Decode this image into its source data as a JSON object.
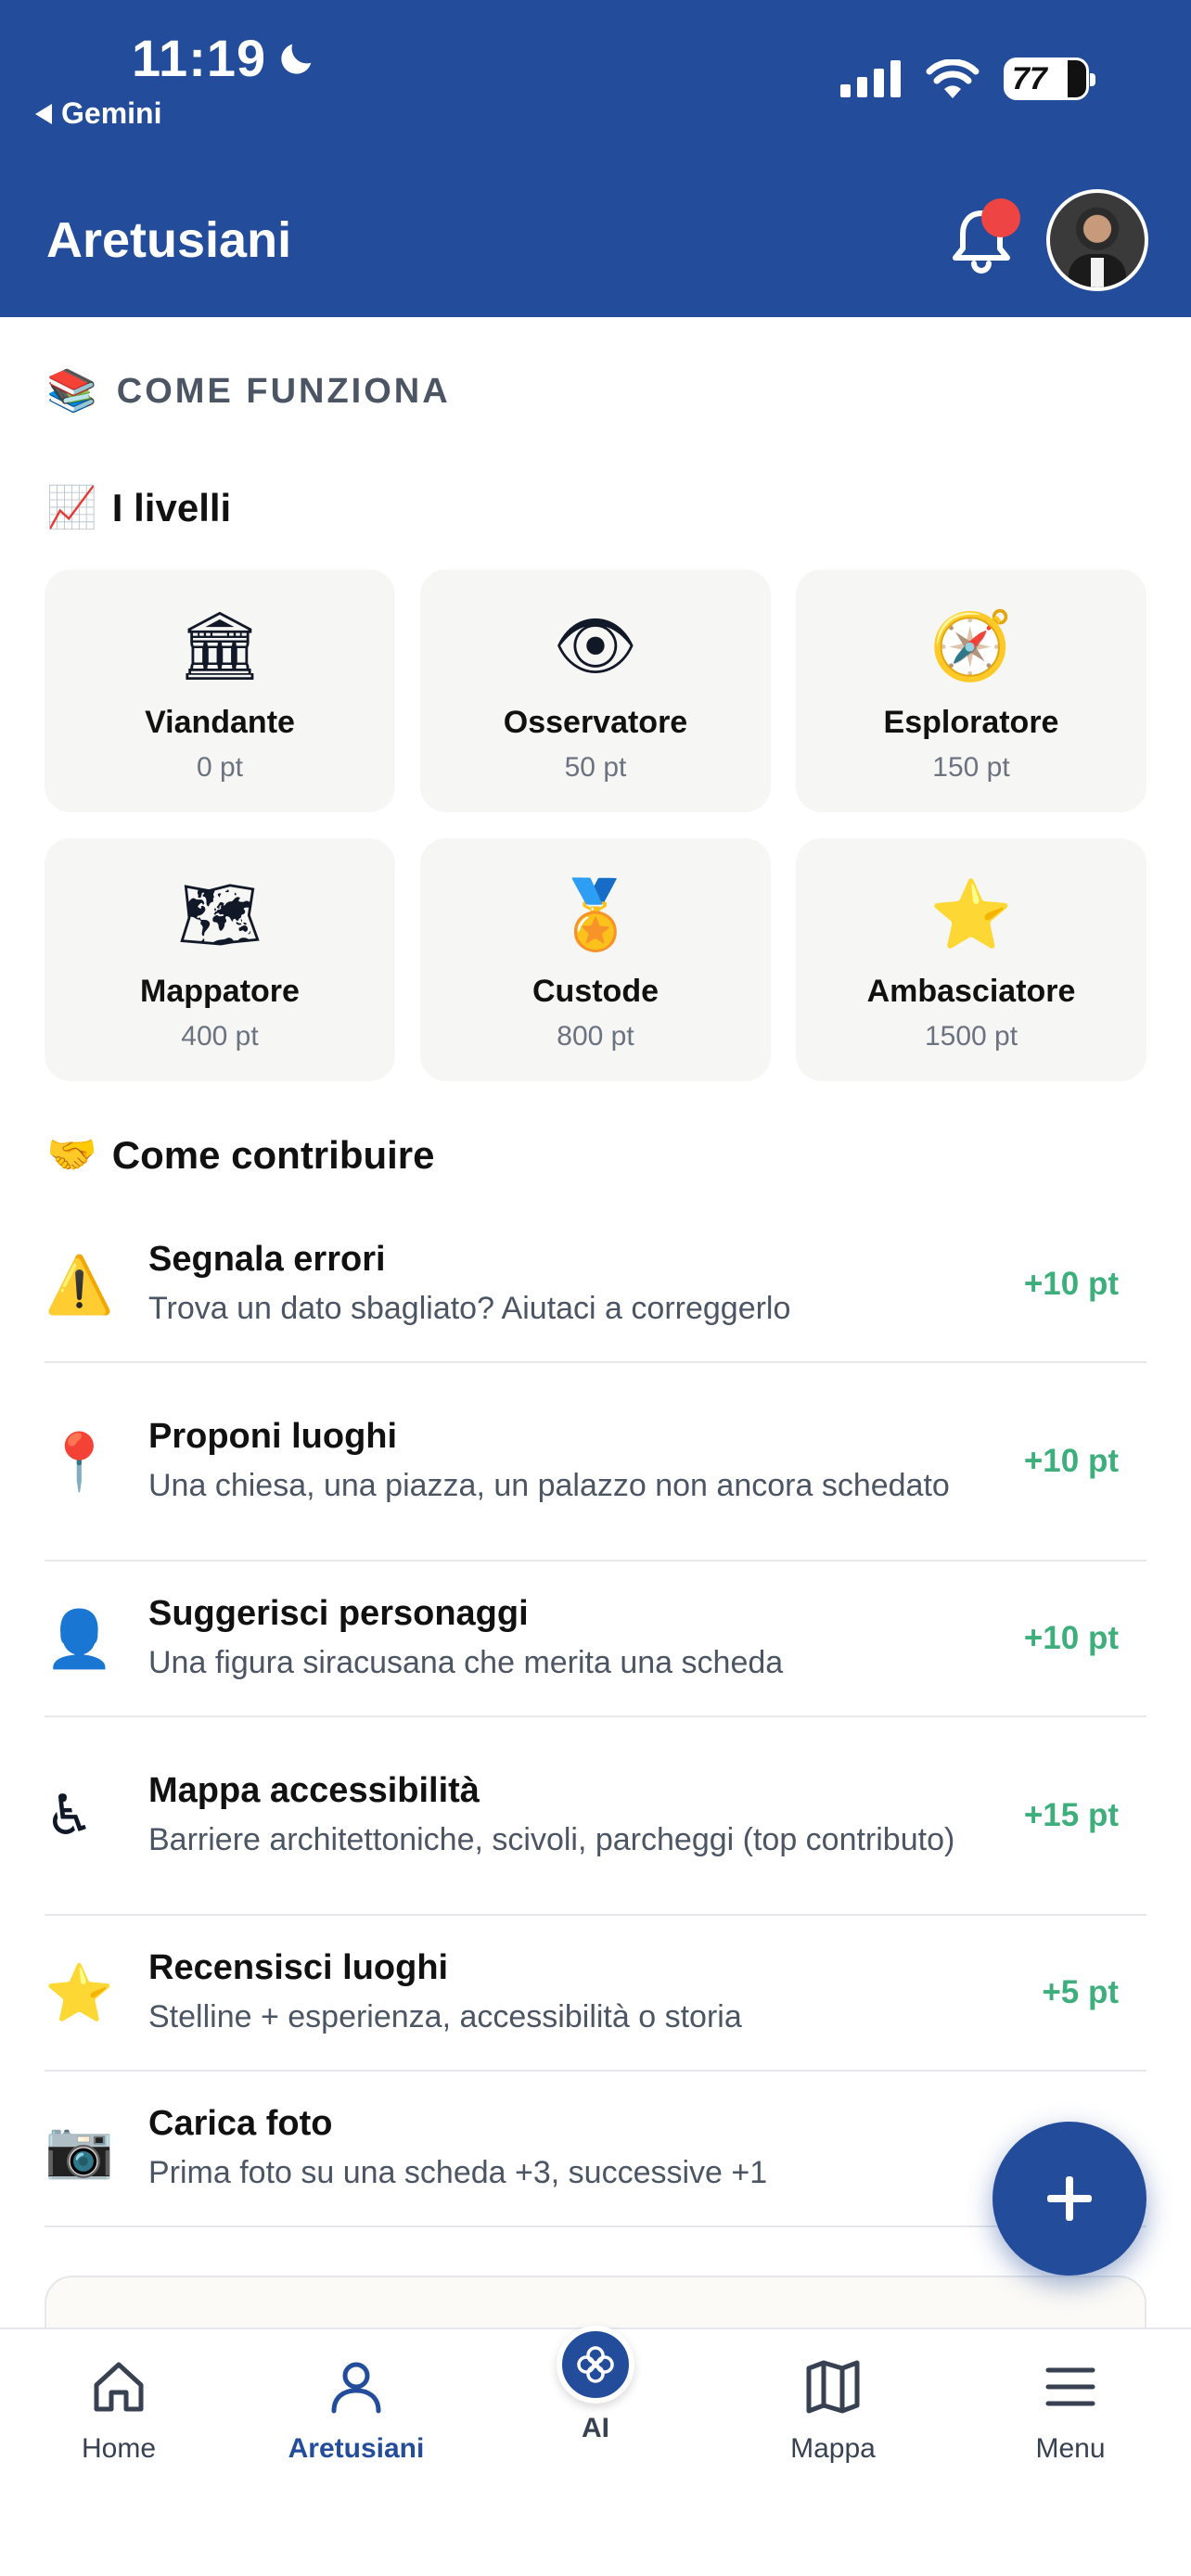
{
  "status_bar": {
    "time": "11:19",
    "back_app": "Gemini",
    "battery": "77",
    "battery_level": 0.77
  },
  "header": {
    "title": "Aretusiani"
  },
  "how_it_works": {
    "label": "COME FUNZIONA",
    "emoji": "📚"
  },
  "levels": {
    "title": "I livelli",
    "emoji": "📈",
    "items": [
      {
        "name": "Viandante",
        "points": "0 pt",
        "emoji": "🏛"
      },
      {
        "name": "Osservatore",
        "points": "50 pt",
        "emoji": "👁"
      },
      {
        "name": "Esploratore",
        "points": "150 pt",
        "emoji": "🧭"
      },
      {
        "name": "Mappatore",
        "points": "400 pt",
        "emoji": "🗺"
      },
      {
        "name": "Custode",
        "points": "800 pt",
        "emoji": "🏅"
      },
      {
        "name": "Ambasciatore",
        "points": "1500 pt",
        "emoji": "⭐"
      }
    ]
  },
  "contribute": {
    "title": "Come contribuire",
    "emoji": "🤝",
    "items": [
      {
        "emoji": "⚠️",
        "title": "Segnala errori",
        "desc": "Trova un dato sbagliato? Aiutaci a correggerlo",
        "points": "+10 pt"
      },
      {
        "emoji": "📍",
        "title": "Proponi luoghi",
        "desc": "Una chiesa, una piazza, un palazzo non ancora schedato",
        "points": "+10 pt"
      },
      {
        "emoji": "👤",
        "title": "Suggerisci personaggi",
        "desc": "Una figura siracusana che merita una scheda",
        "points": "+10 pt"
      },
      {
        "emoji": "♿",
        "title": "Mappa accessibilità",
        "desc": "Barriere architettoniche, scivoli, parcheggi (top contributo)",
        "points": "+15 pt"
      },
      {
        "emoji": "⭐",
        "title": "Recensisci luoghi",
        "desc": "Stelline + esperienza, accessibilità o storia",
        "points": "+5 pt"
      },
      {
        "emoji": "📷",
        "title": "Carica foto",
        "desc": "Prima foto su una scheda +3, successive +1",
        "points": ""
      }
    ]
  },
  "nav": {
    "home": "Home",
    "aretusiani": "Aretusiani",
    "ai": "AI",
    "mappa": "Mappa",
    "menu": "Menu"
  },
  "colors": {
    "brand": "#234c9a",
    "points_green": "#3dae7c",
    "notification": "#ef4444"
  }
}
